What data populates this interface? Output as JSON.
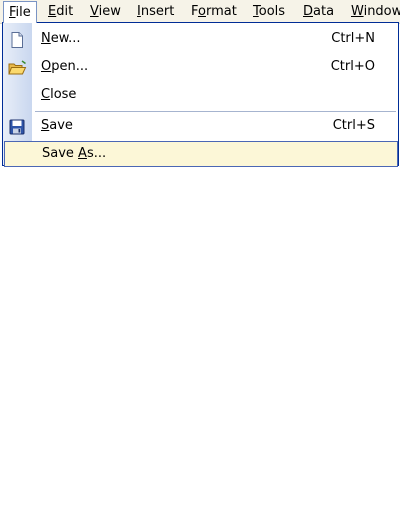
{
  "menubar": {
    "items": [
      {
        "label": "File",
        "mnemonic": "F",
        "rest": "ile"
      },
      {
        "label": "Edit",
        "mnemonic": "E",
        "rest": "dit"
      },
      {
        "label": "View",
        "mnemonic": "V",
        "rest": "iew"
      },
      {
        "label": "Insert",
        "mnemonic": "I",
        "rest": "nsert"
      },
      {
        "label": "Format",
        "pre": "F",
        "mnemonic": "o",
        "rest": "rmat"
      },
      {
        "label": "Tools",
        "mnemonic": "T",
        "rest": "ools"
      },
      {
        "label": "Data",
        "mnemonic": "D",
        "rest": "ata"
      },
      {
        "label": "Window",
        "mnemonic": "W",
        "rest": "indow"
      }
    ]
  },
  "file_menu": {
    "new": {
      "mnemonic": "N",
      "rest": "ew...",
      "shortcut": "Ctrl+N",
      "icon": "new-document-icon"
    },
    "open": {
      "mnemonic": "O",
      "rest": "pen...",
      "shortcut": "Ctrl+O",
      "icon": "open-folder-icon"
    },
    "close": {
      "mnemonic": "C",
      "rest": "lose"
    },
    "save": {
      "mnemonic": "S",
      "rest": "ave",
      "shortcut": "Ctrl+S",
      "icon": "save-disk-icon"
    },
    "save_as": {
      "pre": "Save ",
      "mnemonic": "A",
      "rest": "s..."
    }
  },
  "colors": {
    "menubar_bg": "#f6f3e8",
    "menu_border": "#002d96",
    "highlight_bg": "#fcf7d7",
    "highlight_border": "#4b67b4"
  }
}
